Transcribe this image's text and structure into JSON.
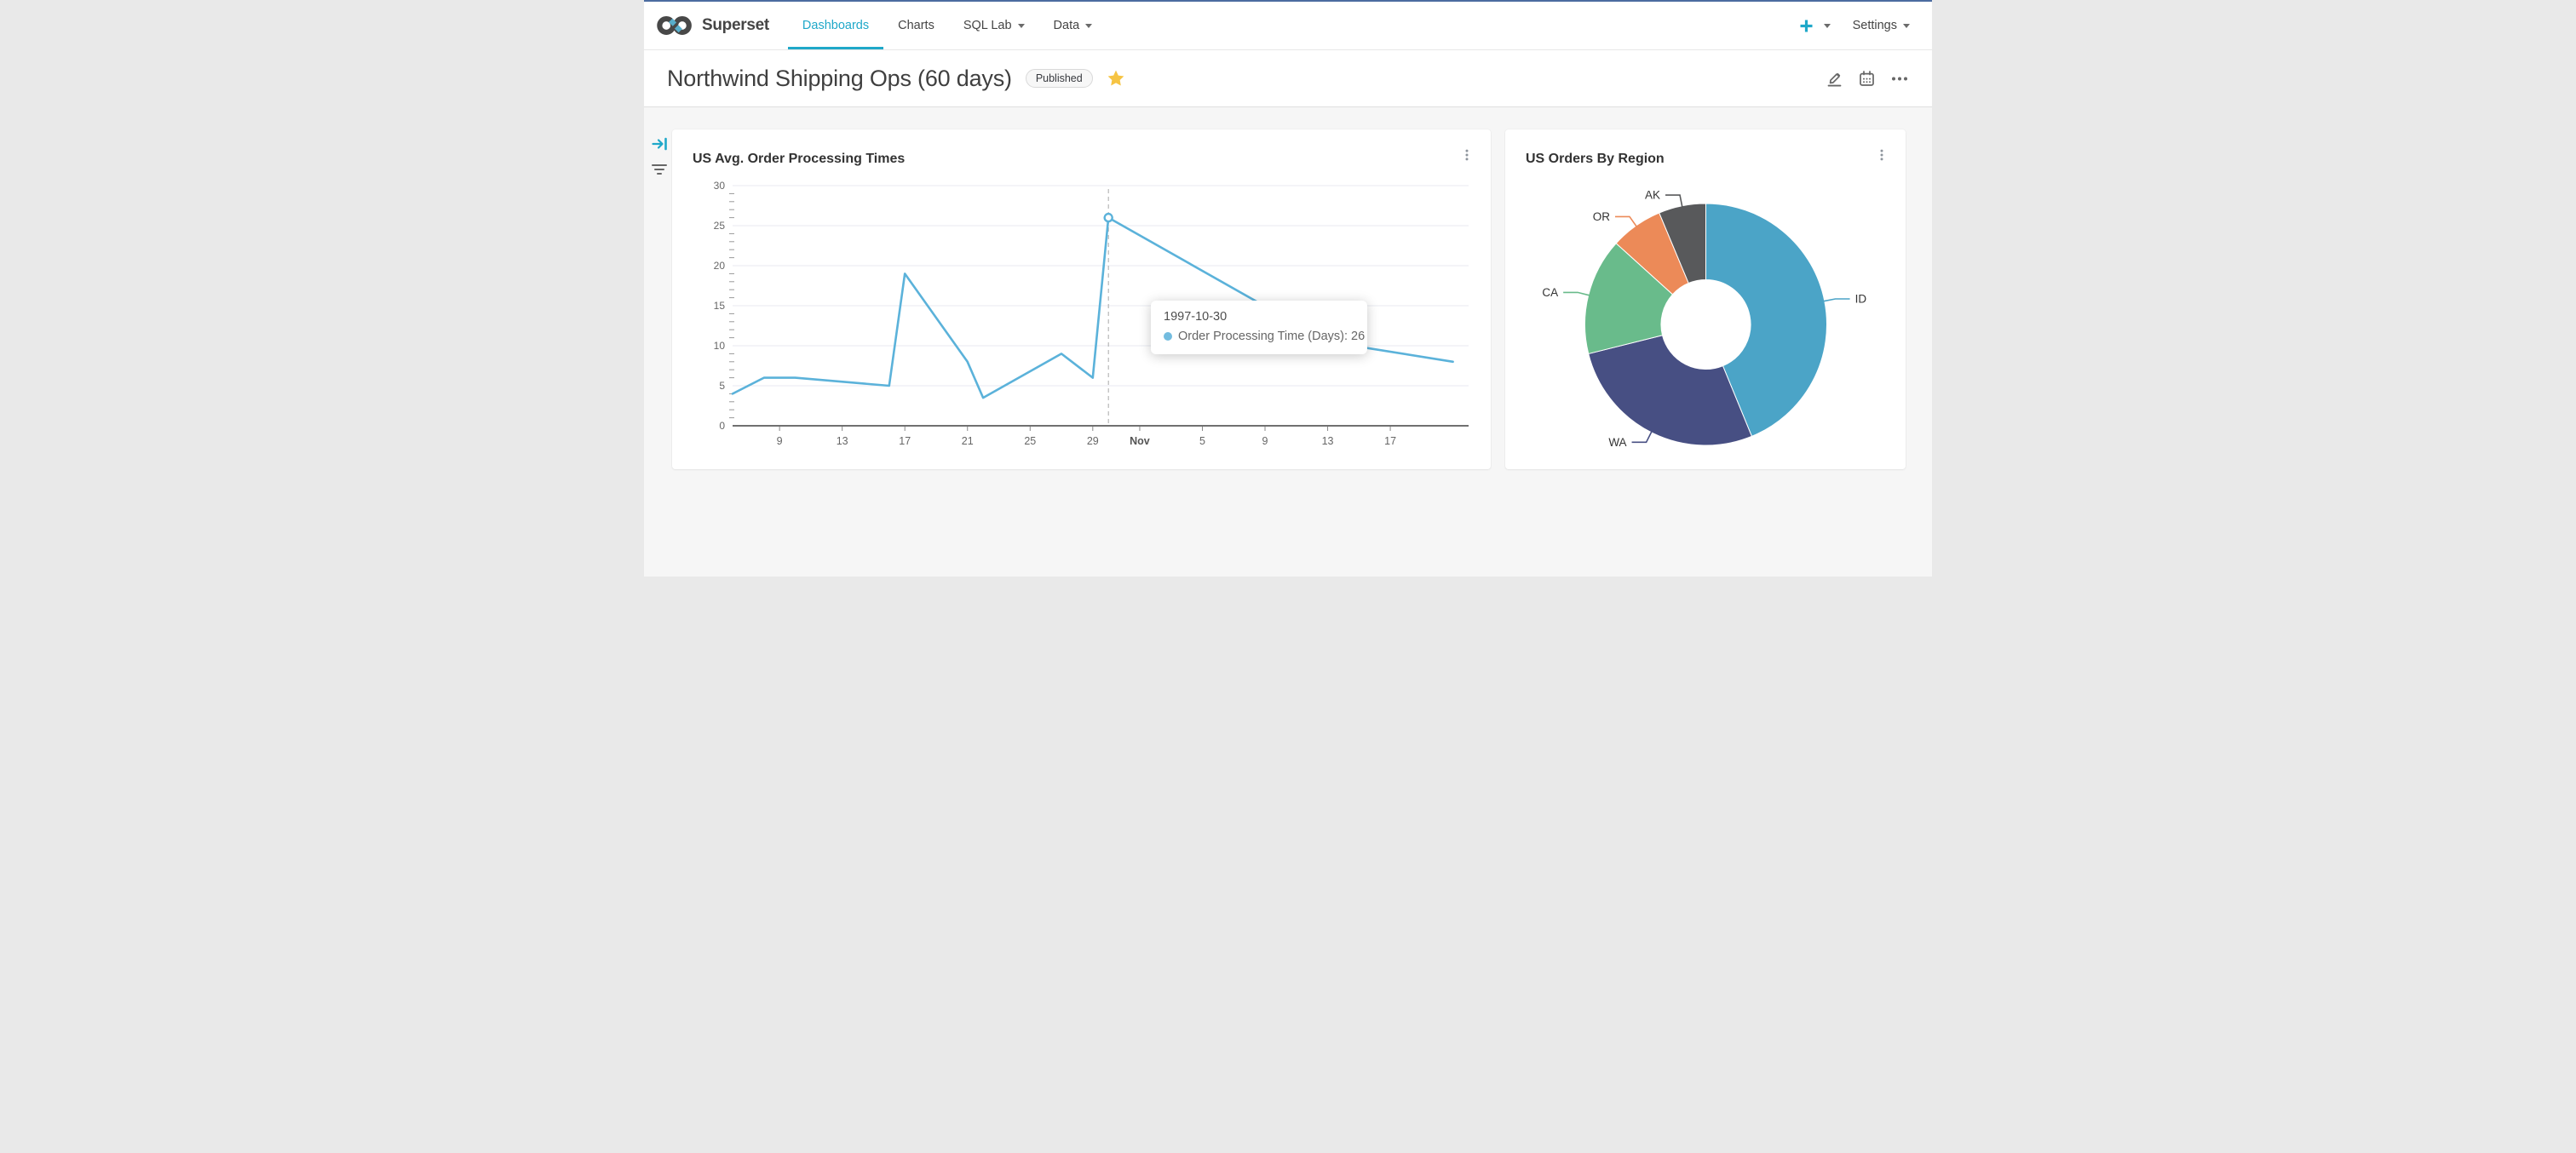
{
  "topbar": {
    "brand": "Superset",
    "nav": [
      {
        "label": "Dashboards",
        "active": true,
        "caret": false
      },
      {
        "label": "Charts",
        "active": false,
        "caret": false
      },
      {
        "label": "SQL Lab",
        "active": false,
        "caret": true
      },
      {
        "label": "Data",
        "active": false,
        "caret": true
      }
    ],
    "settings_label": "Settings"
  },
  "header": {
    "title": "Northwind Shipping Ops (60 days)",
    "published_label": "Published"
  },
  "ui_colors": {
    "accent": "#1FA8C9",
    "topbar_border": "#4C6CA0",
    "star": "#F6C443",
    "icon_gray": "#666666",
    "kebab_gray": "#8E959D"
  },
  "cards": [
    {
      "title": "US Avg. Order Processing Times"
    },
    {
      "title": "US Orders By Region"
    }
  ],
  "tooltip": {
    "title": "1997-10-30",
    "line1": "Order Processing Time (Days): 26"
  },
  "chart_data": [
    {
      "type": "line",
      "title": "US Avg. Order Processing Times",
      "xlabel": "",
      "ylabel": "",
      "ylim": [
        0,
        30
      ],
      "ytick_step": 5,
      "grid": true,
      "xlim": [
        "1997-10-06",
        "1997-11-22"
      ],
      "xticks": [
        {
          "date": "1997-10-09",
          "label": "9"
        },
        {
          "date": "1997-10-13",
          "label": "13"
        },
        {
          "date": "1997-10-17",
          "label": "17"
        },
        {
          "date": "1997-10-21",
          "label": "21"
        },
        {
          "date": "1997-10-25",
          "label": "25"
        },
        {
          "date": "1997-10-29",
          "label": "29"
        },
        {
          "date": "1997-11-01",
          "label": "Nov",
          "bold": true
        },
        {
          "date": "1997-11-05",
          "label": "5"
        },
        {
          "date": "1997-11-09",
          "label": "9"
        },
        {
          "date": "1997-11-13",
          "label": "13"
        },
        {
          "date": "1997-11-17",
          "label": "17"
        }
      ],
      "series": [
        {
          "name": "Order Processing Time (Days)",
          "color": "#5BB2DA",
          "points": [
            [
              "1997-10-06",
              4
            ],
            [
              "1997-10-08",
              6
            ],
            [
              "1997-10-10",
              6
            ],
            [
              "1997-10-16",
              5
            ],
            [
              "1997-10-17",
              19
            ],
            [
              "1997-10-21",
              8
            ],
            [
              "1997-10-22",
              3.5
            ],
            [
              "1997-10-27",
              9
            ],
            [
              "1997-10-29",
              6
            ],
            [
              "1997-10-30",
              26
            ],
            [
              "1997-11-13",
              10.5
            ],
            [
              "1997-11-21",
              8
            ]
          ]
        }
      ],
      "marked_point": {
        "date": "1997-10-30",
        "value": 26
      },
      "axis_pointer_date": "1997-10-30"
    },
    {
      "type": "pie",
      "title": "US Orders By Region",
      "donut": true,
      "inner_radius_ratio": 0.37,
      "start_angle_top": true,
      "clockwise": true,
      "legend_position": "none",
      "labels_outside": true,
      "segments": [
        {
          "label": "ID",
          "value": 43.8,
          "color": "#4BA4C7"
        },
        {
          "label": "WA",
          "value": 27.3,
          "color": "#474F83"
        },
        {
          "label": "CA",
          "value": 15.6,
          "color": "#69BB8B"
        },
        {
          "label": "OR",
          "value": 7.0,
          "color": "#EC8A58"
        },
        {
          "label": "AK",
          "value": 6.3,
          "color": "#58595B"
        }
      ]
    }
  ]
}
